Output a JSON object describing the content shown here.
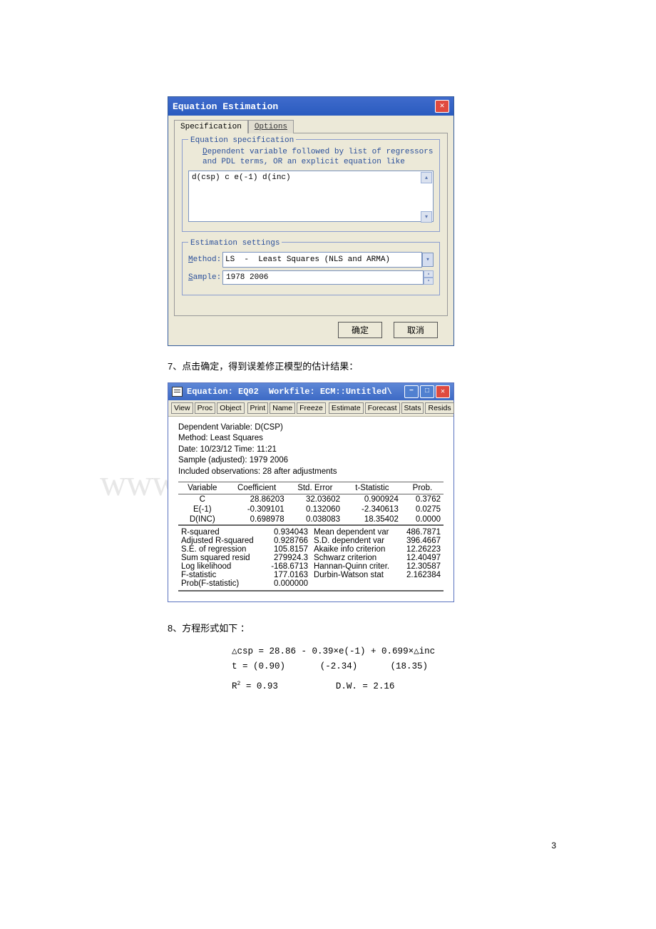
{
  "dialog1": {
    "title": "Equation Estimation",
    "tabs": {
      "spec": "Specification",
      "opt": "Options"
    },
    "spec_legend": "Equation specification",
    "hint1": "Dependent variable followed by list of regressors",
    "hint2": "and PDL terms, OR an explicit equation like",
    "eq_value": "d(csp) c e(-1) d(inc)",
    "est_legend": "Estimation settings",
    "method_label": "Method:",
    "method_value": "LS  -  Least Squares (NLS and ARMA)",
    "sample_label": "Sample:",
    "sample_value": "1978 2006",
    "ok": "确定",
    "cancel": "取消"
  },
  "caption7": "7、点击确定，得到误差修正模型的估计结果：",
  "output": {
    "title_left": "Equation: EQ02",
    "title_right": "Workfile: ECM::Untitled\\",
    "toolbar": [
      "View",
      "Proc",
      "Object",
      "Print",
      "Name",
      "Freeze",
      "Estimate",
      "Forecast",
      "Stats",
      "Resids"
    ],
    "hdr": [
      "Dependent Variable: D(CSP)",
      "Method: Least Squares",
      "Date: 10/23/12   Time: 11:21",
      "Sample (adjusted): 1979 2006",
      "Included observations: 28 after adjustments"
    ],
    "cols": [
      "Variable",
      "Coefficient",
      "Std. Error",
      "t-Statistic",
      "Prob."
    ],
    "rows": [
      {
        "v": "C",
        "c": "28.86203",
        "s": "32.03602",
        "t": "0.900924",
        "p": "0.3762"
      },
      {
        "v": "E(-1)",
        "c": "-0.309101",
        "s": "0.132060",
        "t": "-2.340613",
        "p": "0.0275"
      },
      {
        "v": "D(INC)",
        "c": "0.698978",
        "s": "0.038083",
        "t": "18.35402",
        "p": "0.0000"
      }
    ],
    "stats": [
      [
        "R-squared",
        "0.934043",
        "Mean dependent var",
        "486.7871"
      ],
      [
        "Adjusted R-squared",
        "0.928766",
        "S.D. dependent var",
        "396.4667"
      ],
      [
        "S.E. of regression",
        "105.8157",
        "Akaike info criterion",
        "12.26223"
      ],
      [
        "Sum squared resid",
        "279924.3",
        "Schwarz criterion",
        "12.40497"
      ],
      [
        "Log likelihood",
        "-168.6713",
        "Hannan-Quinn criter.",
        "12.30587"
      ],
      [
        "F-statistic",
        "177.0163",
        "Durbin-Watson stat",
        "2.162384"
      ],
      [
        "Prob(F-statistic)",
        "0.000000",
        "",
        ""
      ]
    ]
  },
  "caption8": "8、方程形式如下 ：",
  "eq": {
    "l1": "△csp = 28.86  -  0.39×e(-1) + 0.699×△inc",
    "l2_left": "t =  (0.90)",
    "l2_mid": "(-2.34)",
    "l2_right": "(18.35)",
    "l3_left": "R",
    "l3_sup": "2",
    "l3_eq": " = 0.93",
    "l3_dw": "D.W. = 2.16"
  },
  "watermark": "www.bdocx.com",
  "page_num": "3"
}
